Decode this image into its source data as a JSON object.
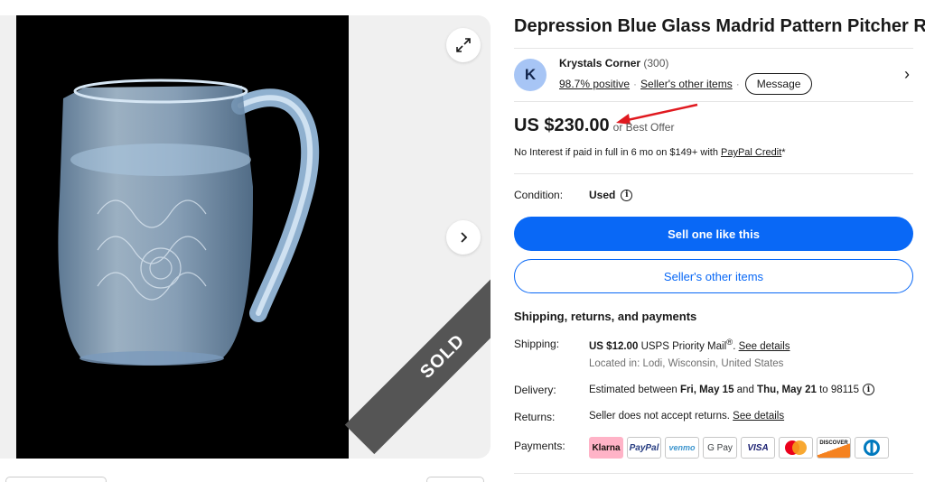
{
  "gallery": {
    "sold_label": "SOLD",
    "expand_icon": "expand-icon",
    "next_icon": "chevron-right-icon"
  },
  "listing": {
    "title": "Depression Blue Glass Madrid Pattern Pitcher RARE"
  },
  "seller": {
    "avatar_letter": "K",
    "name": "Krystals Corner",
    "feedback_count": "(300)",
    "positive": "98.7% positive",
    "other_items_link": "Seller's other items",
    "message_button": "Message"
  },
  "price": {
    "amount": "US $230.00",
    "best_offer": "or Best Offer",
    "credit_prefix": "No Interest if paid in full in 6 mo on $149+ with ",
    "credit_link": "PayPal Credit",
    "credit_suffix": "*"
  },
  "condition": {
    "label": "Condition:",
    "value": "Used"
  },
  "buttons": {
    "sell_one": "Sell one like this",
    "seller_other_items": "Seller's other items"
  },
  "shipping": {
    "heading": "Shipping, returns, and payments",
    "shipping_label": "Shipping:",
    "shipping_cost": "US $12.00",
    "shipping_method": "USPS Priority Mail",
    "shipping_reg": "®",
    "shipping_details": "See details",
    "location": "Located in: Lodi, Wisconsin, United States",
    "delivery_label": "Delivery:",
    "delivery_prefix": "Estimated between ",
    "delivery_start": "Fri, May 15",
    "delivery_and": " and ",
    "delivery_end": "Thu, May 21",
    "delivery_suffix": " to 98115",
    "returns_label": "Returns:",
    "returns_text": "Seller does not accept returns. ",
    "returns_details": "See details",
    "payments_label": "Payments:"
  },
  "payments": [
    "Klarna",
    "PayPal",
    "venmo",
    "G Pay",
    "VISA",
    "mastercard",
    "DISCOVER",
    "diners"
  ],
  "colors": {
    "accent": "#0968f6",
    "annotation_arrow": "#e0191f"
  }
}
